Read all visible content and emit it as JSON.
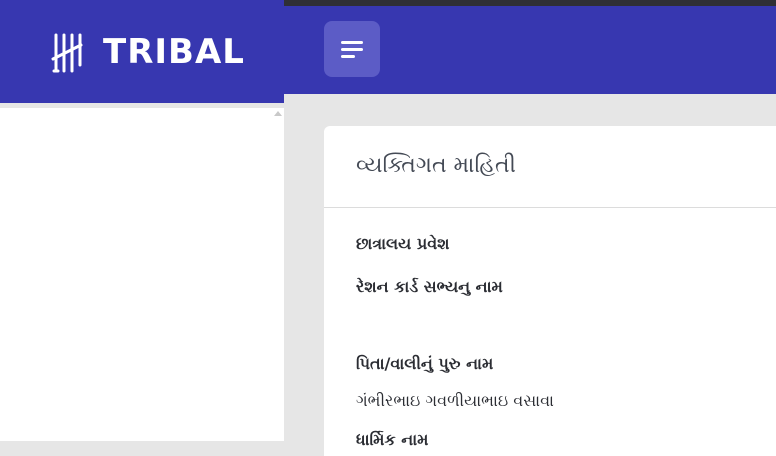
{
  "app": {
    "brand_name": "TRIBAL"
  },
  "header": {
    "menu_icon": "hamburger-menu-icon"
  },
  "card": {
    "title": "વ્યક્તિગત માહિતી",
    "fields": [
      {
        "label": "છાત્રાલય પ્રવેશ",
        "value": ""
      },
      {
        "label": "રેશન કાર્ડ સભ્યનુ નામ",
        "value": ""
      },
      {
        "label": "પિતા/વાલીનું પુરુ નામ",
        "value": "ગંભીરભાઇ ગવળીયાભાઇ વસાવા"
      },
      {
        "label": "ધાર્મિક નામ",
        "value": ""
      }
    ]
  },
  "colors": {
    "header_bg": "#3737b0",
    "menu_button_bg": "#5c5cc6",
    "page_bg": "#e6e6e6"
  }
}
